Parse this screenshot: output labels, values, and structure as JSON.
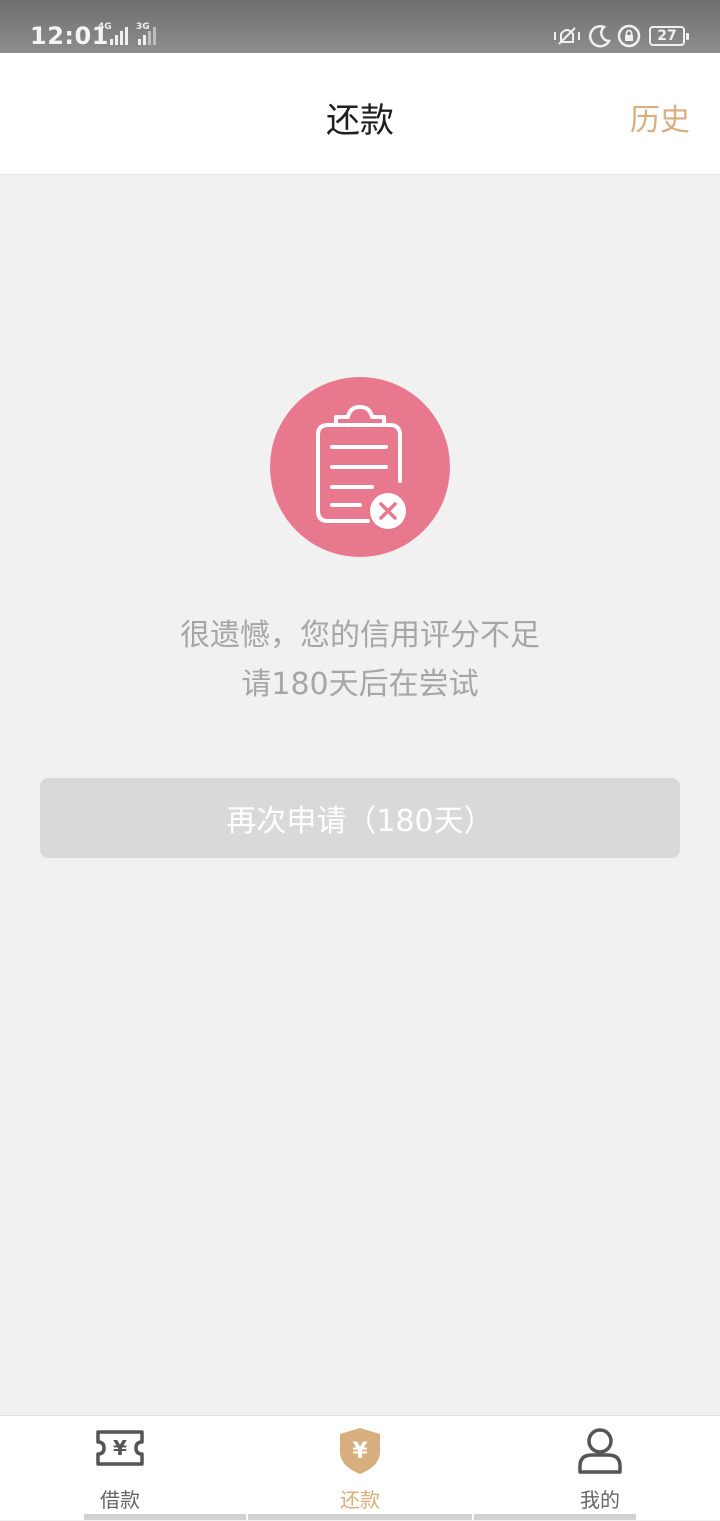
{
  "status_bar": {
    "time": "12:01",
    "network_1": "4G",
    "network_2": "3G",
    "battery": "27"
  },
  "header": {
    "title": "还款",
    "history_label": "历史"
  },
  "main": {
    "icon": "rejected-document-icon",
    "message_line1": "很遗憾，您的信用评分不足",
    "message_line2": "请180天后在尝试",
    "retry_button_label": "再次申请（180天）"
  },
  "tabs": [
    {
      "label": "借款",
      "icon": "loan-ticket-icon",
      "active": false
    },
    {
      "label": "还款",
      "icon": "repay-shield-icon",
      "active": true
    },
    {
      "label": "我的",
      "icon": "person-icon",
      "active": false
    }
  ],
  "colors": {
    "accent": "#d9ae7e",
    "hero": "#e8788d",
    "button_disabled": "#d9d9d9",
    "background": "#f1f1f1"
  }
}
